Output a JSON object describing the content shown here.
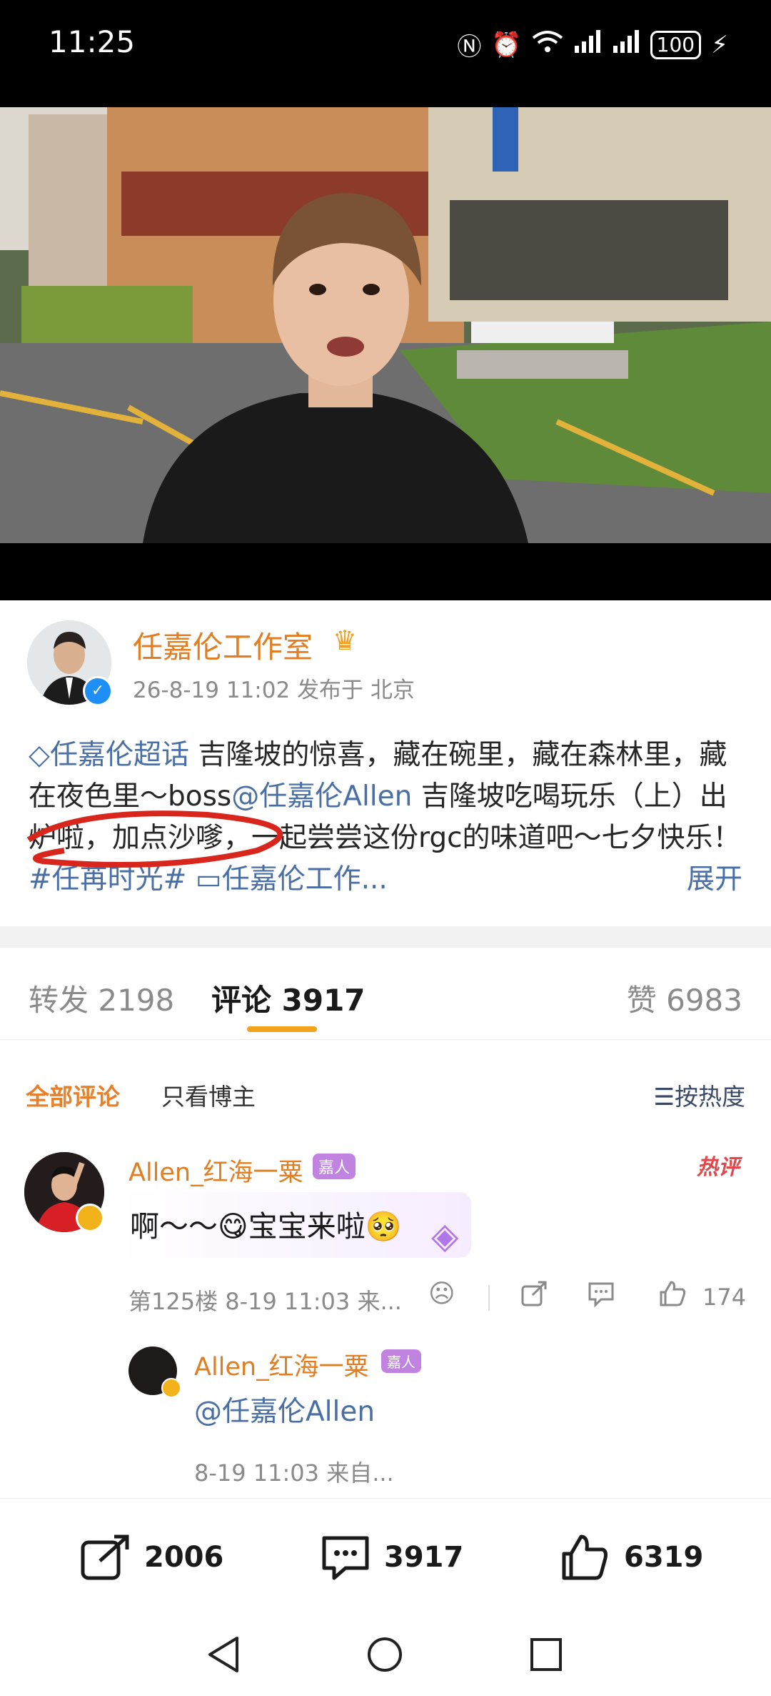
{
  "status_bar": {
    "time": "11:25",
    "icons": [
      "nfc-icon",
      "alarm-icon",
      "wifi-icon",
      "signal-icon",
      "signal-icon"
    ],
    "battery": "100"
  },
  "post": {
    "author": "任嘉伦工作室",
    "time": "26-8-19 11:02",
    "location": "发布于 北京",
    "topic": "◇任嘉伦超话",
    "text_1": " 吉隆坡的惊喜，藏在碗里，藏在森林里，藏在夜色里～boss",
    "mention": "@任嘉伦Allen",
    "text_2": " 吉隆坡吃喝玩乐（上）出炉啦，加点沙嗲，一起尝尝这份rgc的味道吧～七夕快乐！",
    "hashtag": "#任苒时光#",
    "link": " ▭任嘉伦工作...",
    "expand": "展开"
  },
  "tabs": {
    "forward": "转发 2198",
    "comment": "评论 3917",
    "like": "赞 6983"
  },
  "filter": {
    "all": "全部评论",
    "owner_only": "只看博主",
    "sort": "☰按热度"
  },
  "comment": {
    "user": "Allen_红海一粟",
    "level": "嘉人",
    "hot": "热评",
    "text": "啊～～😋宝宝来啦🥺",
    "meta": "第125楼 8-19 11:03 来...",
    "likes": "174"
  },
  "reply": {
    "user": "Allen_红海一粟",
    "level": "嘉人",
    "text": "@任嘉伦Allen",
    "meta": "8-19 11:03 来自..."
  },
  "bottom_bar": {
    "repost": "2006",
    "comment": "3917",
    "like": "6319"
  }
}
